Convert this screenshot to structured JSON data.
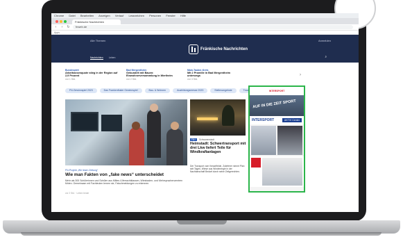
{
  "browser": {
    "menubar": [
      "Chrome",
      "Datei",
      "Bearbeiten",
      "Anzeigen",
      "Verlauf",
      "Lesezeichen",
      "Personen",
      "Fenster",
      "Hilfe"
    ],
    "tab_title": "Fränkische Nachrichten",
    "url": "fnweb.de",
    "bookmarks": "Apps"
  },
  "site": {
    "brand": "Fränkische Nachrichten",
    "header_left": "Alle Themen",
    "header_right": "Anmelden",
    "subnav": [
      "Nachrichten",
      "Leben"
    ],
    "teasers": [
      {
        "kicker": "Bundesweit",
        "title": "Arbeitslosenquote stieg in der Region auf 2,9 Prozent",
        "meta": "vor 1 Std."
      },
      {
        "kicker": "Bad Mergentheim",
        "title": "Gebundelt mit Bauen: Einwohnerversammlung in Wertheim",
        "meta": "vor 2 Std."
      },
      {
        "kicker": "Main-Tauber-Kreis",
        "title": "Mit 2 Promille in Bad Mergentheim unterwegs",
        "meta": "vor 3 Std."
      }
    ],
    "pills": [
      "FN-Gewinnspiel 2023",
      "Das Frankenthaler Gewinnspiel",
      "Bau- & Wohnen",
      "Ausbildungsmesse 2023",
      "Stellenangebote",
      "Traueranzeigen"
    ],
    "main_article": {
      "kicker": "FN-Projekt „Wir lesen Zeitung“",
      "title": "Wie man Fakten von „fake news“ unterscheidet",
      "summary": "Mehr als 300 Schülerinnen und Schüler aus Milten-/Uferrachtklassen, Wiesbaden- und Mehrsprachenzentren fühlen. Gemeinsam mit Fachleuten lernen sie, Falschmeldungen zu erkennen.",
      "meta": "vor 2 Std. · Leben heute"
    },
    "side_article": {
      "tag": "Schwanenstadt",
      "chip": "FN+",
      "title": "Heimstadt: Schwertransport mit drei Lkw liefert Teile für Windkraftanlagen",
      "summary": "Der Transport vom Kesselfelde, Zulieferer nimmt Plan seit Tagen, Wiese aus Windenergie in der Nachbarschaft Bedarf durch seine Zeitgerechten."
    },
    "ad": {
      "brand_top": "INTERSPORT",
      "banner_text": "AUF IN DIE ZEIT SPORT",
      "brand_main": "INTERSPORT",
      "cta": "AKTIV Center"
    }
  },
  "colors": {
    "header_bg": "#1f2d4f",
    "accent": "#2b5bb5",
    "ad_border": "#2bb54a",
    "intersport_red": "#d71d2a",
    "intersport_blue": "#1b3f91"
  }
}
